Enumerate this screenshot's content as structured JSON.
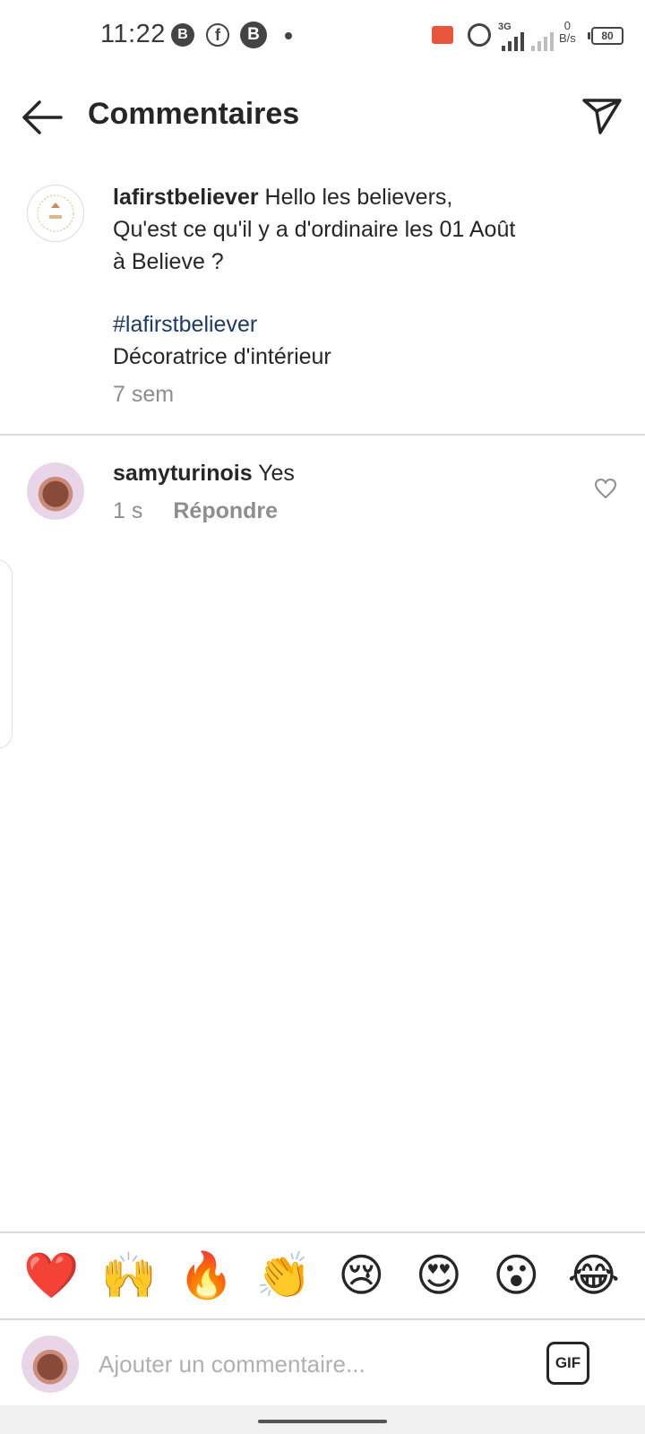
{
  "status_bar": {
    "time": "11:22",
    "speed_value": "0",
    "speed_unit": "B/s",
    "network_type": "3G",
    "battery": "80"
  },
  "header": {
    "title": "Commentaires"
  },
  "caption": {
    "username": "lafirstbeliever",
    "text_line1": "Hello les believers,",
    "text_line2": "Qu'est ce qu'il y a d'ordinaire les 01 Août",
    "text_line3": "à Believe ?",
    "hashtag": "#lafirstbeliever",
    "subtitle": "Décoratrice d'intérieur",
    "time": "7 sem"
  },
  "comments": [
    {
      "username": "samyturinois",
      "text": "Yes",
      "time": "1 s",
      "reply_label": "Répondre"
    }
  ],
  "emoji_bar": [
    "❤️",
    "🙌",
    "🔥",
    "👏",
    "😢",
    "😍",
    "😮",
    "😂"
  ],
  "input": {
    "placeholder": "Ajouter un commentaire...",
    "gif_label": "GIF"
  },
  "colors": {
    "hashtag": "#1e3a66",
    "meta_text": "#8e8e8e",
    "primary_text": "#262626"
  }
}
